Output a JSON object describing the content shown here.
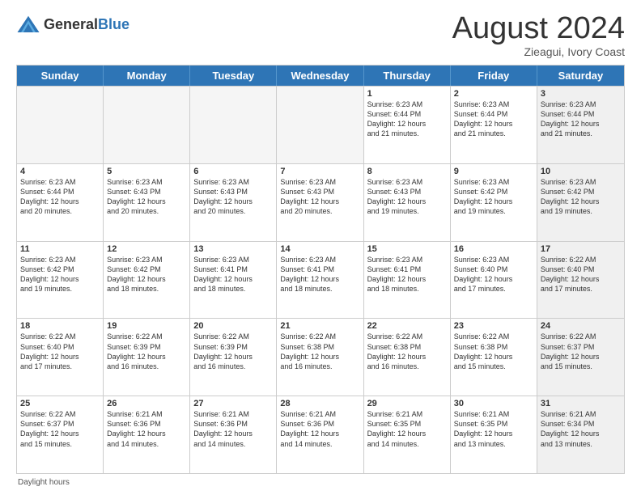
{
  "header": {
    "logo_general": "General",
    "logo_blue": "Blue",
    "month_title": "August 2024",
    "location": "Zieagui, Ivory Coast"
  },
  "weekdays": [
    "Sunday",
    "Monday",
    "Tuesday",
    "Wednesday",
    "Thursday",
    "Friday",
    "Saturday"
  ],
  "footer": {
    "daylight_hours": "Daylight hours"
  },
  "rows": [
    [
      {
        "day": "",
        "text": "",
        "empty": true
      },
      {
        "day": "",
        "text": "",
        "empty": true
      },
      {
        "day": "",
        "text": "",
        "empty": true
      },
      {
        "day": "",
        "text": "",
        "empty": true
      },
      {
        "day": "1",
        "text": "Sunrise: 6:23 AM\nSunset: 6:44 PM\nDaylight: 12 hours\nand 21 minutes."
      },
      {
        "day": "2",
        "text": "Sunrise: 6:23 AM\nSunset: 6:44 PM\nDaylight: 12 hours\nand 21 minutes."
      },
      {
        "day": "3",
        "text": "Sunrise: 6:23 AM\nSunset: 6:44 PM\nDaylight: 12 hours\nand 21 minutes.",
        "shaded": true
      }
    ],
    [
      {
        "day": "4",
        "text": "Sunrise: 6:23 AM\nSunset: 6:44 PM\nDaylight: 12 hours\nand 20 minutes."
      },
      {
        "day": "5",
        "text": "Sunrise: 6:23 AM\nSunset: 6:43 PM\nDaylight: 12 hours\nand 20 minutes."
      },
      {
        "day": "6",
        "text": "Sunrise: 6:23 AM\nSunset: 6:43 PM\nDaylight: 12 hours\nand 20 minutes."
      },
      {
        "day": "7",
        "text": "Sunrise: 6:23 AM\nSunset: 6:43 PM\nDaylight: 12 hours\nand 20 minutes."
      },
      {
        "day": "8",
        "text": "Sunrise: 6:23 AM\nSunset: 6:43 PM\nDaylight: 12 hours\nand 19 minutes."
      },
      {
        "day": "9",
        "text": "Sunrise: 6:23 AM\nSunset: 6:42 PM\nDaylight: 12 hours\nand 19 minutes."
      },
      {
        "day": "10",
        "text": "Sunrise: 6:23 AM\nSunset: 6:42 PM\nDaylight: 12 hours\nand 19 minutes.",
        "shaded": true
      }
    ],
    [
      {
        "day": "11",
        "text": "Sunrise: 6:23 AM\nSunset: 6:42 PM\nDaylight: 12 hours\nand 19 minutes."
      },
      {
        "day": "12",
        "text": "Sunrise: 6:23 AM\nSunset: 6:42 PM\nDaylight: 12 hours\nand 18 minutes."
      },
      {
        "day": "13",
        "text": "Sunrise: 6:23 AM\nSunset: 6:41 PM\nDaylight: 12 hours\nand 18 minutes."
      },
      {
        "day": "14",
        "text": "Sunrise: 6:23 AM\nSunset: 6:41 PM\nDaylight: 12 hours\nand 18 minutes."
      },
      {
        "day": "15",
        "text": "Sunrise: 6:23 AM\nSunset: 6:41 PM\nDaylight: 12 hours\nand 18 minutes."
      },
      {
        "day": "16",
        "text": "Sunrise: 6:23 AM\nSunset: 6:40 PM\nDaylight: 12 hours\nand 17 minutes."
      },
      {
        "day": "17",
        "text": "Sunrise: 6:22 AM\nSunset: 6:40 PM\nDaylight: 12 hours\nand 17 minutes.",
        "shaded": true
      }
    ],
    [
      {
        "day": "18",
        "text": "Sunrise: 6:22 AM\nSunset: 6:40 PM\nDaylight: 12 hours\nand 17 minutes."
      },
      {
        "day": "19",
        "text": "Sunrise: 6:22 AM\nSunset: 6:39 PM\nDaylight: 12 hours\nand 16 minutes."
      },
      {
        "day": "20",
        "text": "Sunrise: 6:22 AM\nSunset: 6:39 PM\nDaylight: 12 hours\nand 16 minutes."
      },
      {
        "day": "21",
        "text": "Sunrise: 6:22 AM\nSunset: 6:38 PM\nDaylight: 12 hours\nand 16 minutes."
      },
      {
        "day": "22",
        "text": "Sunrise: 6:22 AM\nSunset: 6:38 PM\nDaylight: 12 hours\nand 16 minutes."
      },
      {
        "day": "23",
        "text": "Sunrise: 6:22 AM\nSunset: 6:38 PM\nDaylight: 12 hours\nand 15 minutes."
      },
      {
        "day": "24",
        "text": "Sunrise: 6:22 AM\nSunset: 6:37 PM\nDaylight: 12 hours\nand 15 minutes.",
        "shaded": true
      }
    ],
    [
      {
        "day": "25",
        "text": "Sunrise: 6:22 AM\nSunset: 6:37 PM\nDaylight: 12 hours\nand 15 minutes."
      },
      {
        "day": "26",
        "text": "Sunrise: 6:21 AM\nSunset: 6:36 PM\nDaylight: 12 hours\nand 14 minutes."
      },
      {
        "day": "27",
        "text": "Sunrise: 6:21 AM\nSunset: 6:36 PM\nDaylight: 12 hours\nand 14 minutes."
      },
      {
        "day": "28",
        "text": "Sunrise: 6:21 AM\nSunset: 6:36 PM\nDaylight: 12 hours\nand 14 minutes."
      },
      {
        "day": "29",
        "text": "Sunrise: 6:21 AM\nSunset: 6:35 PM\nDaylight: 12 hours\nand 14 minutes."
      },
      {
        "day": "30",
        "text": "Sunrise: 6:21 AM\nSunset: 6:35 PM\nDaylight: 12 hours\nand 13 minutes."
      },
      {
        "day": "31",
        "text": "Sunrise: 6:21 AM\nSunset: 6:34 PM\nDaylight: 12 hours\nand 13 minutes.",
        "shaded": true
      }
    ]
  ]
}
